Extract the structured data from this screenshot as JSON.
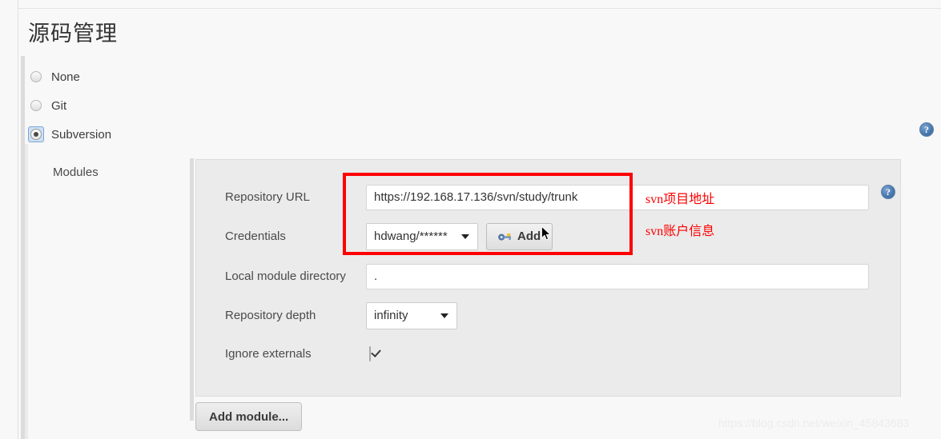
{
  "page": {
    "title": "源码管理",
    "watermark": "https://blog.csdn.net/weixin_45843683"
  },
  "scm_options": [
    {
      "label": "None",
      "selected": false
    },
    {
      "label": "Git",
      "selected": false
    },
    {
      "label": "Subversion",
      "selected": true
    }
  ],
  "modules": {
    "section_label": "Modules",
    "add_module_label": "Add module...",
    "fields": {
      "repository_url": {
        "label": "Repository URL",
        "value": "https://192.168.17.136/svn/study/trunk"
      },
      "credentials": {
        "label": "Credentials",
        "value": "hdwang/******",
        "add_button_label": "Add"
      },
      "local_module_directory": {
        "label": "Local module directory",
        "value": "."
      },
      "repository_depth": {
        "label": "Repository depth",
        "value": "infinity"
      },
      "ignore_externals": {
        "label": "Ignore externals",
        "checked": true
      }
    }
  },
  "annotations": {
    "repository_url_note": "svn项目地址",
    "credentials_note": "svn账户信息",
    "color": "#fe0000"
  },
  "icons": {
    "help": "?"
  }
}
